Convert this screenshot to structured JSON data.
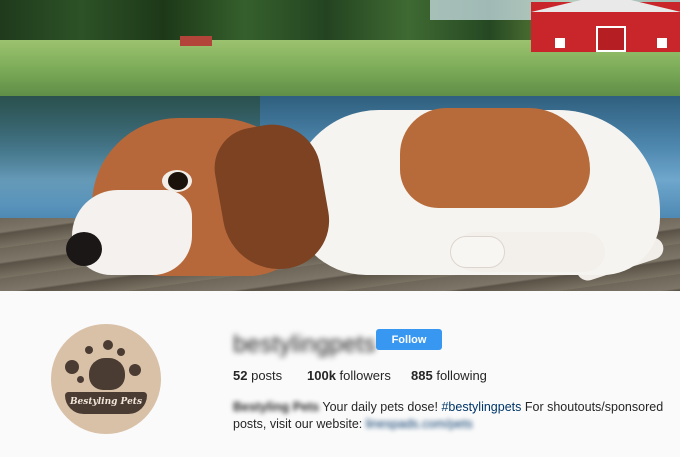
{
  "profile": {
    "username": "bestylingpets",
    "follow_label": "Follow",
    "avatar_brand": "Bestyling Pets",
    "stats": {
      "posts_count": "52",
      "posts_label": "posts",
      "followers_count": "100k",
      "followers_label": "followers",
      "following_count": "885",
      "following_label": "following"
    },
    "bio": {
      "name": "Bestyling Pets",
      "text_1": "Your daily pets dose!",
      "hashtag": "#bestylingpets",
      "text_2": "For shoutouts/sponsored posts,",
      "text_3": "visit our website:",
      "link": "linespads.com/pets"
    }
  },
  "colors": {
    "follow_button": "#3897f0",
    "hashtag": "#003569",
    "background": "#fafafa",
    "avatar_bg": "#d9c1a8"
  }
}
